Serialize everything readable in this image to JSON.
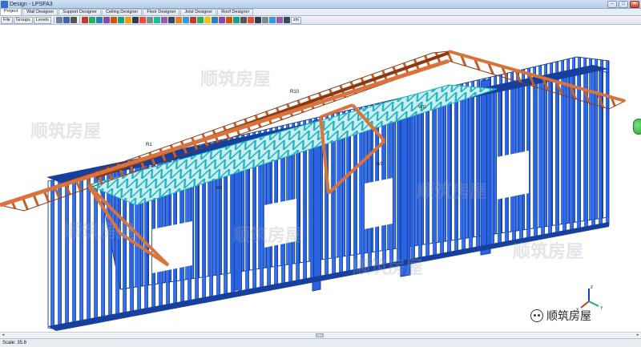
{
  "window": {
    "title": "Design - LPSFA3",
    "controls": [
      "–",
      "□",
      "✕"
    ]
  },
  "tabs": [
    {
      "label": "Project",
      "active": true
    },
    {
      "label": "Wall Designer",
      "active": false
    },
    {
      "label": "Support Designer",
      "active": false
    },
    {
      "label": "Ceiling Designer",
      "active": false
    },
    {
      "label": "Floor Designer",
      "active": false
    },
    {
      "label": "Joist Designer",
      "active": false
    },
    {
      "label": "Roof Designer",
      "active": false
    }
  ],
  "toolbar": {
    "file_label": "File",
    "groups_label": "Groups",
    "levels_label": "Levels",
    "zoom_label": "zm"
  },
  "model_labels": {
    "r10": "R10",
    "r1": "R1",
    "w1": "W1",
    "w11": "W11",
    "w3": "W3"
  },
  "axis": {
    "x": "X",
    "y": "Y",
    "z": "Z"
  },
  "status": {
    "scale_text": "Scale: 35.6"
  },
  "watermark": {
    "text": "顺筑房屋"
  },
  "brand": {
    "text": "顺筑房屋"
  },
  "colors": {
    "steel": "#2a63e0",
    "steel_dark": "#163f9e",
    "roof": "#d9733b",
    "roof_dark": "#8a3a12",
    "truss_web": "#2fd6c0",
    "accent": "#2f6fd0"
  },
  "icons": [
    "file-icon",
    "house-icon",
    "pointer-icon",
    "heart-icon",
    "zoom-icon",
    "axis-icon",
    "brand-icon"
  ]
}
